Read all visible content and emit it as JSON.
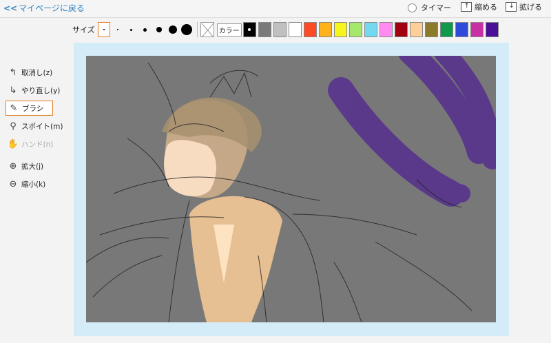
{
  "topbar": {
    "back_chevron": "<<",
    "back_label": "マイページに戻る",
    "timer_label": "タイマー",
    "shrink_label": "縮める",
    "expand_label": "拡げる"
  },
  "toolbar": {
    "size_label": "サイズ",
    "sizes": [
      1,
      2,
      3,
      5,
      8,
      12,
      16
    ],
    "selected_size_index": 0,
    "color_label": "カラー",
    "selected_color_index": 0,
    "colors": [
      "#000000",
      "#7a7a7a",
      "#c0c0c0",
      "#ffffff",
      "#ff4a26",
      "#ffb21c",
      "#f7f51e",
      "#a6e86e",
      "#74d9f0",
      "#ff8af0",
      "#a00010",
      "#ffcf99",
      "#8a7a2a",
      "#0e9a4a",
      "#2e4ad8",
      "#c82fa3",
      "#4a0f96"
    ]
  },
  "tools": [
    {
      "label": "取消し(z)",
      "icon": "undo-icon",
      "state": "normal"
    },
    {
      "label": "やり直し(y)",
      "icon": "redo-icon",
      "state": "normal"
    },
    {
      "label": "ブラシ",
      "icon": "brush-icon",
      "state": "selected"
    },
    {
      "label": "スポイト(m)",
      "icon": "eyedropper-icon",
      "state": "normal"
    },
    {
      "label": "ハンド(n)",
      "icon": "hand-icon",
      "state": "disabled"
    },
    {
      "label": "拡大(j)",
      "icon": "zoom-in-icon",
      "state": "normal"
    },
    {
      "label": "縮小(k)",
      "icon": "zoom-out-icon",
      "state": "normal"
    }
  ],
  "canvas": {
    "background": "#777777",
    "frame_color": "#d4ecf8"
  }
}
